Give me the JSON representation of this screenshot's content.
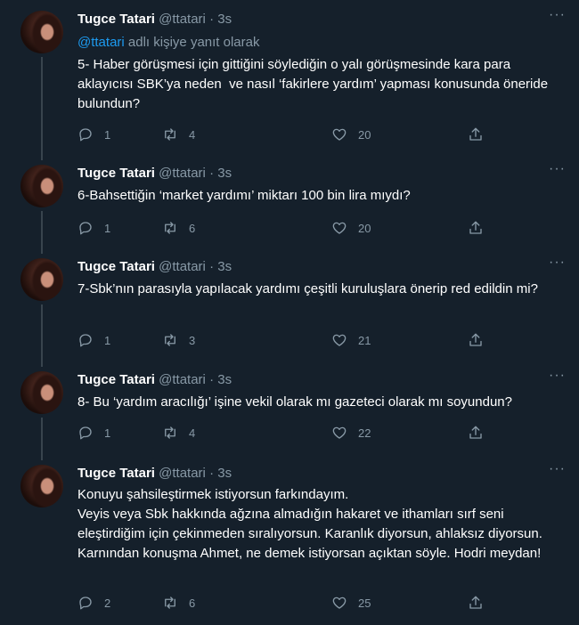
{
  "tweets": [
    {
      "name": "Tugce Tatari",
      "handle": "@ttatari",
      "dot": "·",
      "time": "3s",
      "reply_prefix": "@ttatari",
      "reply_suffix": " adlı kişiye yanıt olarak",
      "text": "5- Haber görüşmesi için gittiğini söylediğin o yalı görüşmesinde kara para aklayıcısı SBK’ya neden  ve nasıl ‘fakirlere yardım’ yapması konusunda öneride bulundun?",
      "replies": "1",
      "retweets": "4",
      "likes": "20"
    },
    {
      "name": "Tugce Tatari",
      "handle": "@ttatari",
      "dot": "·",
      "time": "3s",
      "text": "6-Bahsettiğin ‘market yardımı’ miktarı 100 bin lira mıydı?",
      "replies": "1",
      "retweets": "6",
      "likes": "20"
    },
    {
      "name": "Tugce Tatari",
      "handle": "@ttatari",
      "dot": "·",
      "time": "3s",
      "text": "7-Sbk’nın parasıyla yapılacak yardımı çeşitli kuruluşlara önerip red edildin mi?",
      "replies": "1",
      "retweets": "3",
      "likes": "21"
    },
    {
      "name": "Tugce Tatari",
      "handle": "@ttatari",
      "dot": "·",
      "time": "3s",
      "text": "8- Bu ‘yardım aracılığı’ işine vekil olarak mı gazeteci olarak mı soyundun?",
      "replies": "1",
      "retweets": "4",
      "likes": "22"
    },
    {
      "name": "Tugce Tatari",
      "handle": "@ttatari",
      "dot": "·",
      "time": "3s",
      "text": "Konuyu şahsileştirmek istiyorsun farkındayım.\nVeyis veya Sbk hakkında ağzına almadığın hakaret ve ithamları sırf seni eleştirdiğim için çekinmeden sıralıyorsun. Karanlık diyorsun, ahlaksız diyorsun. Karnından konuşma Ahmet, ne demek istiyorsan açıktan söyle. Hodri meydan!",
      "replies": "2",
      "retweets": "6",
      "likes": "25"
    }
  ],
  "icons": {
    "reply": "reply-icon",
    "retweet": "retweet-icon",
    "like": "heart-icon",
    "share": "share-icon",
    "more": "more-icon"
  },
  "colors": {
    "background": "#15202b",
    "text": "#ffffff",
    "secondary": "#8899a6",
    "link": "#1d9bf0",
    "divider": "#38444d"
  }
}
